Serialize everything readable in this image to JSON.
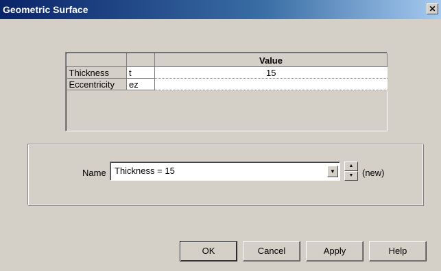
{
  "window": {
    "title": "Geometric Surface",
    "close_glyph": "✕"
  },
  "table": {
    "headers": [
      "",
      "",
      "Value"
    ],
    "rows": [
      {
        "label": "Thickness",
        "symbol": "t",
        "value": "15"
      },
      {
        "label": "Eccentricity",
        "symbol": "ez",
        "value": ""
      }
    ]
  },
  "name_group": {
    "label": "Name",
    "selected_value": "Thickness = 15",
    "dropdown_icon": "chevron-down-icon",
    "spin_up_icon": "spin-up-icon",
    "spin_down_icon": "spin-down-icon",
    "new_label": "(new)"
  },
  "buttons": {
    "ok": "OK",
    "cancel": "Cancel",
    "apply": "Apply",
    "help": "Help"
  }
}
